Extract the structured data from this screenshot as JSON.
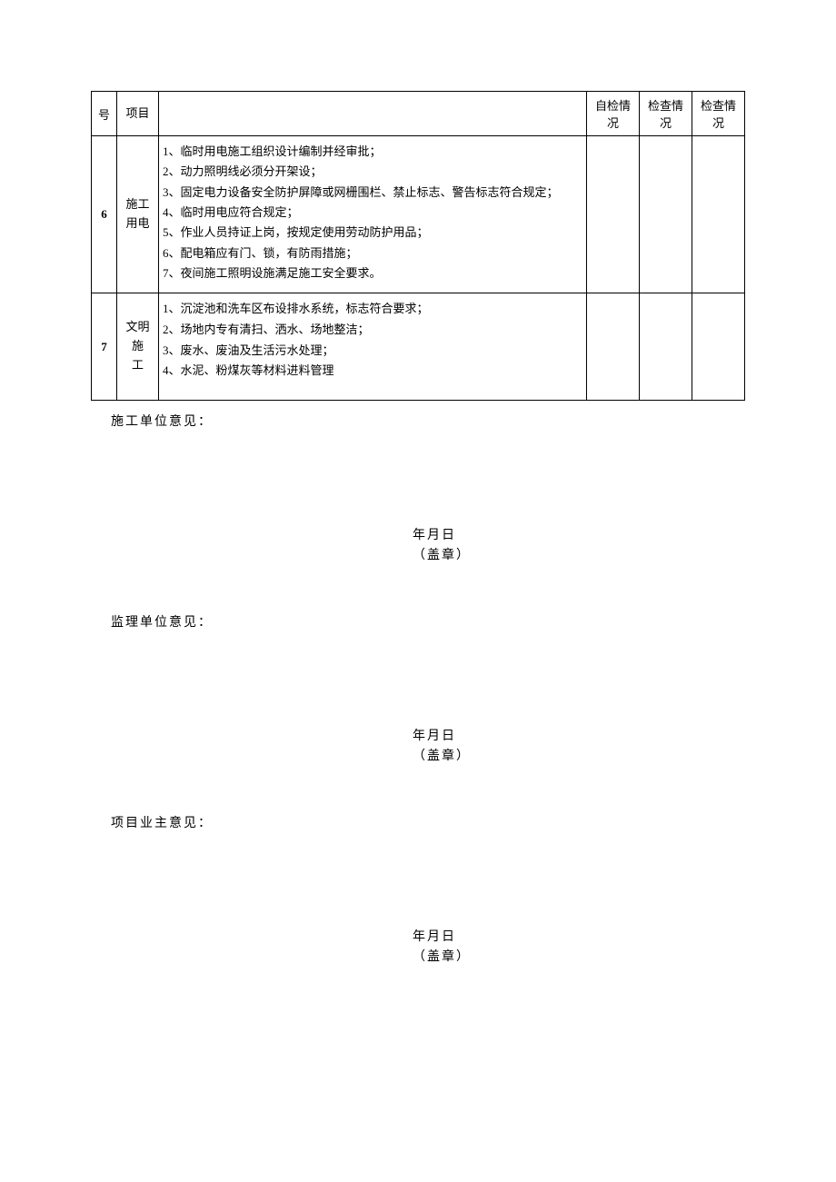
{
  "table": {
    "headers": {
      "num": "号",
      "project": "项目",
      "desc": "",
      "self": "自检情况",
      "check1": "检查情况",
      "check2": "检查情况"
    },
    "rows": [
      {
        "num": "6",
        "project": "施工\n用电",
        "desc": "1、临时用电施工组织设计编制并经审批；\n2、动力照明线必须分开架设；\n3、固定电力设备安全防护屏障或网栅围栏、禁止标志、警告标志符合规定；\n4、临时用电应符合规定；\n5、作业人员持证上岗，按规定使用劳动防护用品；\n6、配电箱应有门、锁，有防雨措施；\n7、夜间施工照明设施满足施工安全要求。",
        "self": "",
        "check1": "",
        "check2": ""
      },
      {
        "num": "7",
        "project": "文明施\n工",
        "desc": "1、沉淀池和洗车区布设排水系统，标志符合要求；\n2、场地内专有清扫、洒水、场地整洁；\n3、废水、废油及生活污水处理；\n4、水泥、粉煤灰等材料进料管理",
        "self": "",
        "check1": "",
        "check2": ""
      }
    ]
  },
  "signatures": {
    "block1": {
      "label": "施工单位意见：",
      "date": "年月日",
      "seal": "（盖章）"
    },
    "block2": {
      "label": "监理单位意见：",
      "date": "年月日",
      "seal": "（盖章）"
    },
    "block3": {
      "label": "项目业主意见：",
      "date": "年月日",
      "seal": "（盖章）"
    }
  }
}
